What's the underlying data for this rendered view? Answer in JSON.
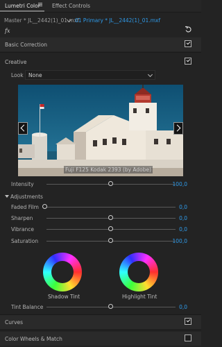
{
  "tabs": [
    {
      "label": "Lumetri Color",
      "active": true
    },
    {
      "label": "Effect Controls",
      "active": false
    }
  ],
  "source": {
    "master_label": "Master * JL__2442(1)_01.mxf",
    "clip_label": "01 Primary * JL__2442(1)_01.mxf"
  },
  "fx_label": "fx",
  "sections": {
    "basic_correction": "Basic Correction",
    "creative": "Creative",
    "curves": "Curves",
    "color_wheels": "Color Wheels & Match"
  },
  "look": {
    "label": "Look",
    "value": "None"
  },
  "preview": {
    "caption": "Fuji F125 Kodak 2393 (by Adobe)"
  },
  "intensity": {
    "label": "Intensity",
    "value": "100,0",
    "fraction": 0.5
  },
  "adjustments": {
    "title": "Adjustments",
    "sliders": [
      {
        "label": "Faded Film",
        "value": "0,0",
        "fraction": 0.0
      },
      {
        "label": "Sharpen",
        "value": "0,0",
        "fraction": 0.5
      },
      {
        "label": "Vibrance",
        "value": "0,0",
        "fraction": 0.5
      },
      {
        "label": "Saturation",
        "value": "100,0",
        "fraction": 0.5
      }
    ],
    "shadow_tint": "Shadow Tint",
    "highlight_tint": "Highlight Tint",
    "tint_balance": {
      "label": "Tint Balance",
      "value": "0,0",
      "fraction": 0.5
    }
  },
  "colors": {
    "accent": "#2f9ae8",
    "background": "#232323"
  },
  "icons": [
    "menu-icon",
    "dropdown-chevron-icon",
    "reset-icon",
    "checkbox-icon",
    "chevron-left-icon",
    "chevron-right-icon",
    "disclosure-triangle-icon"
  ]
}
